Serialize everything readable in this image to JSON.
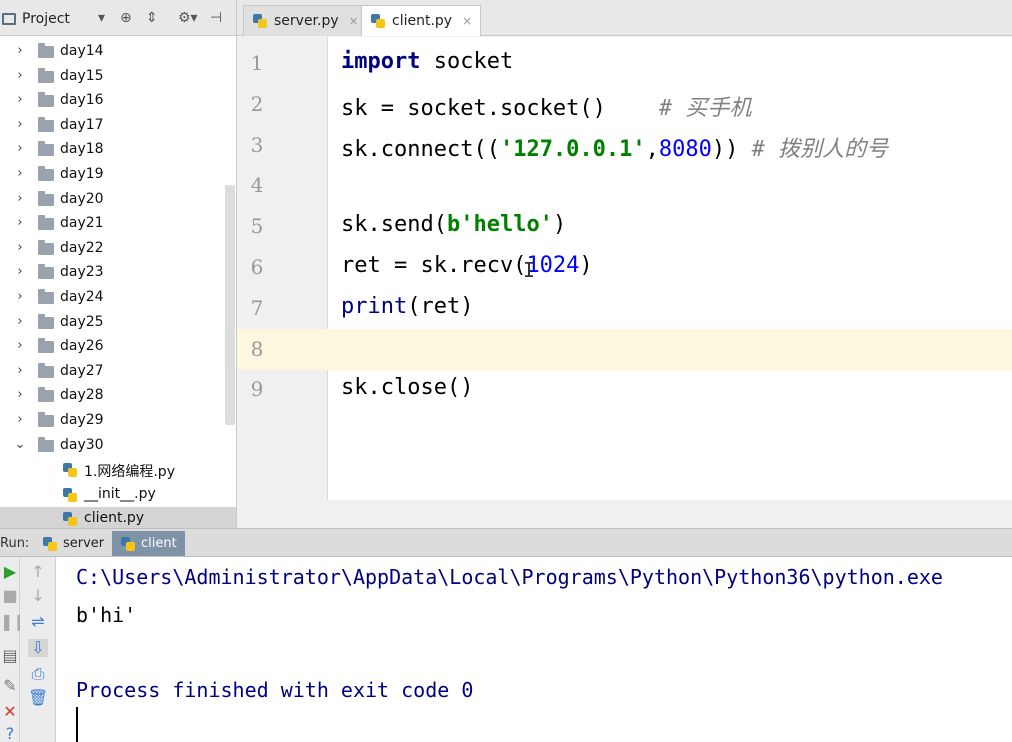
{
  "project": {
    "title": "Project",
    "folders": [
      "day14",
      "day15",
      "day16",
      "day17",
      "day18",
      "day19",
      "day20",
      "day21",
      "day22",
      "day23",
      "day24",
      "day25",
      "day26",
      "day27",
      "day28",
      "day29"
    ],
    "open_folder": "day30",
    "files": [
      "1.网络编程.py",
      "__init__.py",
      "client.py"
    ],
    "selected_file": "client.py"
  },
  "editor": {
    "tabs": [
      {
        "label": "server.py",
        "active": false
      },
      {
        "label": "client.py",
        "active": true
      }
    ],
    "current_line": 8,
    "lines": [
      {
        "num": "1",
        "code": [
          "import",
          " socket"
        ]
      },
      {
        "num": "2",
        "code": [
          "sk = socket.socket()",
          "    # 买手机"
        ]
      },
      {
        "num": "3",
        "code": [
          "sk.connect((",
          "'127.0.0.1'",
          ",",
          "8080",
          "))",
          " # 拨别人的号"
        ]
      },
      {
        "num": "4",
        "code": []
      },
      {
        "num": "5",
        "code": [
          "sk.send(",
          "b'hello'",
          ")"
        ]
      },
      {
        "num": "6",
        "code": [
          "ret = sk.recv(",
          "1024",
          ")"
        ]
      },
      {
        "num": "7",
        "code": [
          "print",
          "(ret)"
        ]
      },
      {
        "num": "8",
        "code": []
      },
      {
        "num": "9",
        "code": [
          "sk.close()"
        ]
      }
    ]
  },
  "run": {
    "label": "Run:",
    "tabs": [
      {
        "label": "server",
        "active": false
      },
      {
        "label": "client",
        "active": true
      }
    ],
    "console": [
      {
        "text": "C:\\Users\\Administrator\\AppData\\Local\\Programs\\Python\\Python36\\python.exe",
        "color": "#000080"
      },
      {
        "text": "b'hi'",
        "color": "#000000"
      },
      {
        "text": "",
        "color": "#000000"
      },
      {
        "text": "Process finished with exit code 0",
        "color": "#000080"
      }
    ]
  },
  "icons": {
    "tab_close": "×",
    "chevron_right": "›",
    "chevron_down": "⌄"
  }
}
